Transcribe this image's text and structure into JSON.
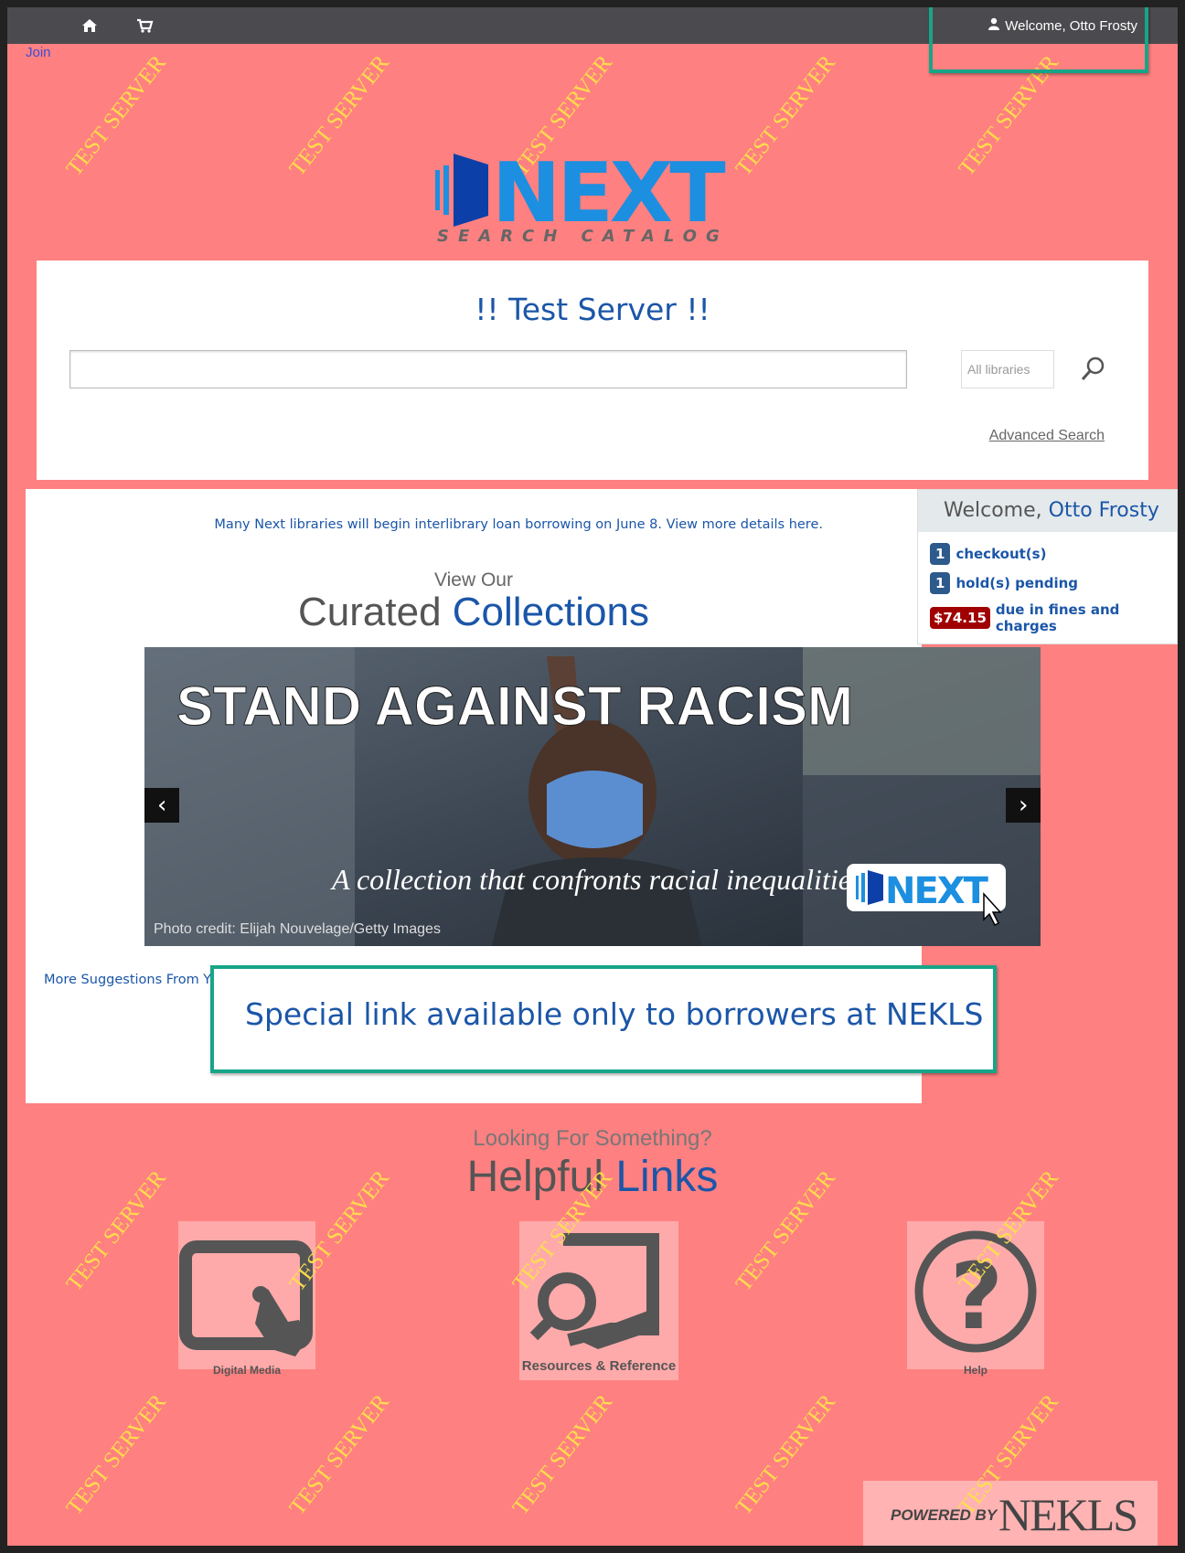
{
  "topbar": {
    "home_icon": "home-icon",
    "cart_icon": "cart-icon",
    "user_icon": "user-icon",
    "welcome_text": "Welcome, Otto Frosty"
  },
  "join_link": "Join",
  "watermark": "TEST SERVER",
  "logo": {
    "word": "NEXT",
    "subtitle": "SEARCH CATALOG",
    "color": "#1c8fe0"
  },
  "search": {
    "title": "!! Test Server !!",
    "input_value": "",
    "library_select": "All libraries",
    "search_icon": "search-icon",
    "advanced_label": "Advanced Search"
  },
  "main": {
    "notice": "Many Next libraries will begin interlibrary loan borrowing on June 8. View more details here.",
    "view_our": "View Our",
    "curated_word": "Curated",
    "collections_word": "Collections",
    "carousel": {
      "headline": "STAND AGAINST RACISM",
      "tagline": "A collection that confronts racial inequalities.",
      "credit": "Photo credit: Elijah Nouvelage/Getty Images",
      "badge": "NEXT",
      "prev_label": "‹",
      "next_label": "›"
    },
    "more_suggestions": "More Suggestions From Your Library",
    "special_link": "Special link available only to borrowers at NEKLS"
  },
  "sidebar": {
    "welcome_prefix": "Welcome,",
    "user_name": "Otto Frosty",
    "checkouts_count": "1",
    "checkouts_label": "checkout(s)",
    "holds_count": "1",
    "holds_label": "hold(s) pending",
    "fines_amount": "$74.15",
    "fines_label": "due in fines and charges"
  },
  "helpful": {
    "looking": "Looking For Something?",
    "helpful_word": "Helpful",
    "links_word": "Links",
    "tiles": [
      {
        "label": "Digital Media",
        "icon": "tablet-touch-icon"
      },
      {
        "label": "Resources & Reference",
        "icon": "magnifier-document-icon"
      },
      {
        "label": "Help",
        "icon": "question-circle-icon"
      }
    ]
  },
  "footer": {
    "powered_by": "POWERED BY",
    "nekls": "NEKLS"
  },
  "colors": {
    "page_bg": "#ff8080",
    "topbar": "#4b4b4f",
    "link_blue": "#1b56a8",
    "highlight": "#17a589",
    "watermark": "#ffe14a"
  }
}
